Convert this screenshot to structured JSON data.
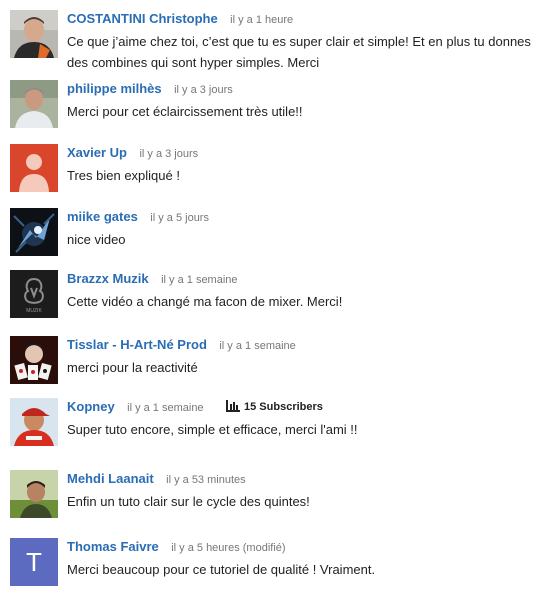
{
  "comments": [
    {
      "author": "COSTANTINI Christophe",
      "time": "il y a 1 heure",
      "text": "Ce que j’aime chez toi, c’est que tu es super clair et simple! Et en plus tu donnes des combines qui sont hyper simples. Merci",
      "avatar": "photo-man-dark-shirt"
    },
    {
      "author": "philippe milhès",
      "time": "il y a 3 jours",
      "text": "Merci pour cet éclaircissement très utile!!",
      "avatar": "photo-man-outdoors"
    },
    {
      "author": "Xavier Up",
      "time": "il y a 3 jours",
      "text": "Tres bien expliqué !",
      "avatar": "default-user-icon"
    },
    {
      "author": "miike gates",
      "time": "il y a 5 jours",
      "text": "nice video",
      "avatar": "photo-dark-abstract"
    },
    {
      "author": "Brazzx Muzik",
      "time": "il y a 1 semaine",
      "text": "Cette vidéo a changé ma facon de mixer. Merci!",
      "avatar": "logo-muzik",
      "avatar_logo_text": "MUZIK"
    },
    {
      "author": "Tisslar - H-Art-Né Prod",
      "time": "il y a 1 semaine",
      "text": "merci pour la reactivité",
      "avatar": "photo-playing-cards"
    },
    {
      "author": "Kopney",
      "time": "il y a 1 semaine",
      "text": "Super tuto encore, simple et efficace, merci l'ami !!",
      "avatar": "photo-man-red-cap",
      "subscribers": "15 Subscribers"
    },
    {
      "author": "Mehdi Laanait",
      "time": "il y a 53 minutes",
      "text": "Enfin un tuto clair sur le cycle des quintes!",
      "avatar": "photo-man-green-field"
    },
    {
      "author": "Thomas Faivre",
      "time": "il y a 5 heures (modifié)",
      "text": "Merci beaucoup pour ce tutoriel de qualité ! Vraiment.",
      "avatar": "letter-avatar",
      "avatar_letter": "T"
    }
  ],
  "colors": {
    "author_link": "#2a6db5",
    "timestamp": "#777777",
    "text": "#222222",
    "default_avatar_bg": "#d9462b",
    "letter_avatar_bg": "#5c6bc0"
  }
}
